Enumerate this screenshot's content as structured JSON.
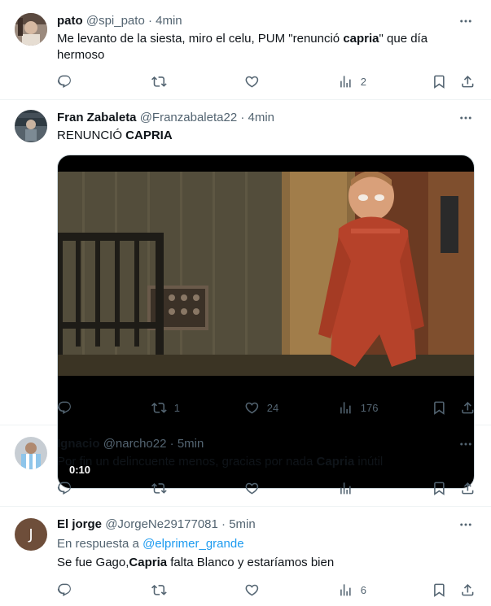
{
  "tweets": [
    {
      "name": "pato",
      "handle": "@spi_pato",
      "time": "4min",
      "text_parts": [
        "Me levanto de la siesta, miro el celu, PUM \"renunció ",
        "capria",
        "\" que día hermoso"
      ],
      "counts": {
        "reply": "",
        "retweet": "",
        "like": "",
        "views": "2"
      }
    },
    {
      "name": "Fran Zabaleta",
      "handle": "@Franzabaleta22",
      "time": "4min",
      "text_parts": [
        "RENUNCIÓ ",
        "CAPRIA"
      ],
      "media": {
        "duration": "0:10"
      },
      "counts": {
        "reply": "",
        "retweet": "1",
        "like": "24",
        "views": "176"
      }
    },
    {
      "name": "Ignacio",
      "handle": "@narcho22",
      "time": "5min",
      "text_parts": [
        "Por fin un delincuente menos, gracias por nada ",
        "Capria",
        " inútil"
      ],
      "counts": {
        "reply": "",
        "retweet": "",
        "like": "",
        "views": ""
      }
    },
    {
      "name": "El jorge",
      "handle": "@JorgeNe29177081",
      "time": "5min",
      "avatar_initial": "J",
      "reply_to_prefix": "En respuesta a ",
      "reply_to_handle": "@elprimer_grande",
      "text_parts": [
        "Se fue Gago,",
        "Capria",
        " falta Blanco y estaríamos bien"
      ],
      "counts": {
        "reply": "",
        "retweet": "",
        "like": "",
        "views": "6"
      }
    }
  ],
  "separator": "·",
  "colors": {
    "text": "#0f1419",
    "secondary": "#536471",
    "link": "#1d9bf0",
    "border": "#eff3f4",
    "avatar_jorge": "#6e4e3a"
  }
}
